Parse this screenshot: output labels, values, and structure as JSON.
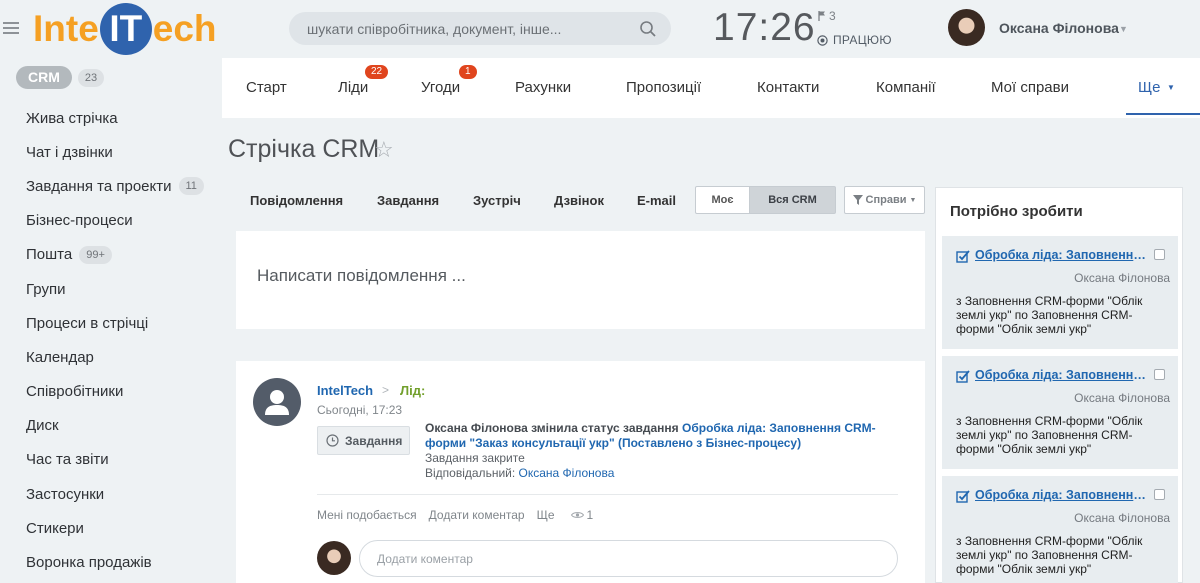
{
  "header": {
    "logo_left": "Inte",
    "logo_circle": "IT",
    "logo_right": "ech",
    "search_placeholder": "шукати співробітника, документ, інше...",
    "time": "17:26",
    "flag_count": "3",
    "work_status": "ПРАЦЮЮ",
    "user_name": "Оксана Філонова"
  },
  "sidebar": {
    "crm_label": "CRM",
    "crm_count": "23",
    "items": [
      {
        "label": "Жива стрічка",
        "count": null
      },
      {
        "label": "Чат і дзвінки",
        "count": null
      },
      {
        "label": "Завдання та проекти",
        "count": "11"
      },
      {
        "label": "Бізнес-процеси",
        "count": null
      },
      {
        "label": "Пошта",
        "count": "99+"
      },
      {
        "label": "Групи",
        "count": null
      },
      {
        "label": "Процеси в стрічці",
        "count": null
      },
      {
        "label": "Календар",
        "count": null
      },
      {
        "label": "Співробітники",
        "count": null
      },
      {
        "label": "Диск",
        "count": null
      },
      {
        "label": "Час та звіти",
        "count": null
      },
      {
        "label": "Застосунки",
        "count": null
      },
      {
        "label": "Стикери",
        "count": null
      },
      {
        "label": "Воронка продажів",
        "count": null
      }
    ]
  },
  "topnav": {
    "tabs": [
      {
        "label": "Старт",
        "badge": null
      },
      {
        "label": "Ліди",
        "badge": "22"
      },
      {
        "label": "Угоди",
        "badge": "1"
      },
      {
        "label": "Рахунки",
        "badge": null
      },
      {
        "label": "Пропозиції",
        "badge": null
      },
      {
        "label": "Контакти",
        "badge": null
      },
      {
        "label": "Компанії",
        "badge": null
      },
      {
        "label": "Мої справи",
        "badge": null
      }
    ],
    "more_label": "Ще"
  },
  "page": {
    "title": "Стрічка CRM"
  },
  "activity_bar": {
    "message": "Повідомлення",
    "task": "Завдання",
    "meeting": "Зустріч",
    "call": "Дзвінок",
    "email": "E-mail",
    "filter_my": "Моє",
    "filter_all": "Вся CRM",
    "deals_dropdown": "Справи"
  },
  "message_box": {
    "placeholder": "Написати повідомлення ..."
  },
  "feed_item": {
    "author": "IntelTech",
    "target": "Лід:",
    "time": "Сьогодні, 17:23",
    "chip_label": "Завдання",
    "actor": "Оксана Філонова",
    "action": " змінила статус завдання ",
    "task_link": "Обробка ліда: Заповнення CRM-форми \"Заказ консультації укр\" (Поставлено з Бізнес-процесу)",
    "status": "Завдання закрите",
    "responsible_label": "Відповідальний:",
    "responsible": "Оксана Філонова",
    "like": "Мені подобається",
    "comment": "Додати коментар",
    "more": "Ще",
    "views": "1",
    "comment_placeholder": "Додати коментар"
  },
  "todo": {
    "title": "Потрібно зробити",
    "cards": [
      {
        "link": "Обробка ліда: Заповнення CRM-форми",
        "responsible": "Оксана Філонова",
        "desc": "з Заповнення CRM-форми \"Облік землі укр\" по Заповнення CRM-форми \"Облік землі укр\""
      },
      {
        "link": "Обробка ліда: Заповнення CRM-форми",
        "responsible": "Оксана Філонова",
        "desc": "з Заповнення CRM-форми \"Облік землі укр\" по Заповнення CRM-форми \"Облік землі укр\""
      },
      {
        "link": "Обробка ліда: Заповнення CRM-форми",
        "responsible": "Оксана Філонова",
        "desc": "з Заповнення CRM-форми \"Облік землі укр\" по Заповнення CRM-форми \"Облік землі укр\""
      }
    ]
  },
  "colors": {
    "brand_orange": "#f5a023",
    "brand_blue": "#2f63ad",
    "link_blue": "#2067b0",
    "badge_red": "#e0451e",
    "lead_green": "#72a02c"
  }
}
